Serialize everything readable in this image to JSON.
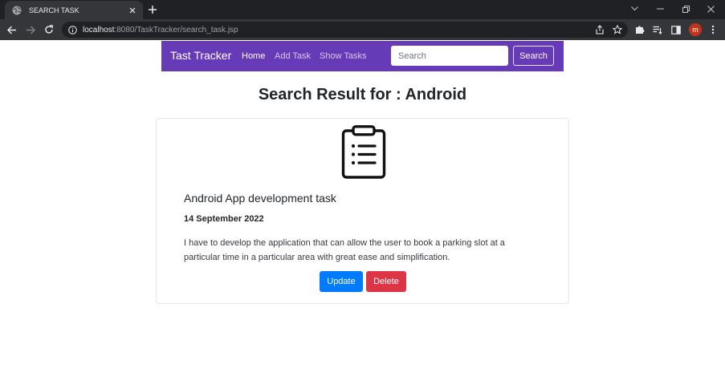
{
  "browser": {
    "tab_title": "SEARCH TASK",
    "url_host": "localhost",
    "url_rest": ":8080/TaskTracker/search_task.jsp",
    "profile_initial": "m"
  },
  "navbar": {
    "brand": "Tast Tracker",
    "links": [
      {
        "label": "Home",
        "active": true
      },
      {
        "label": "Add Task",
        "active": false
      },
      {
        "label": "Show Tasks",
        "active": false
      }
    ],
    "search_placeholder": "Search",
    "search_value": "",
    "search_button": "Search"
  },
  "heading": "Search Result for : Android",
  "card": {
    "icon": "clipboard-list-icon",
    "title": "Android App development task",
    "date": "14 September 2022",
    "description": "I have to develop the application that can allow the user to book a parking slot at a particular time in a particular area with great ease and simplification.",
    "update_label": "Update",
    "delete_label": "Delete"
  },
  "colors": {
    "navbar": "#673ab7",
    "update": "#007bff",
    "delete": "#dc3545",
    "nav_link": "#d8c9f0"
  }
}
